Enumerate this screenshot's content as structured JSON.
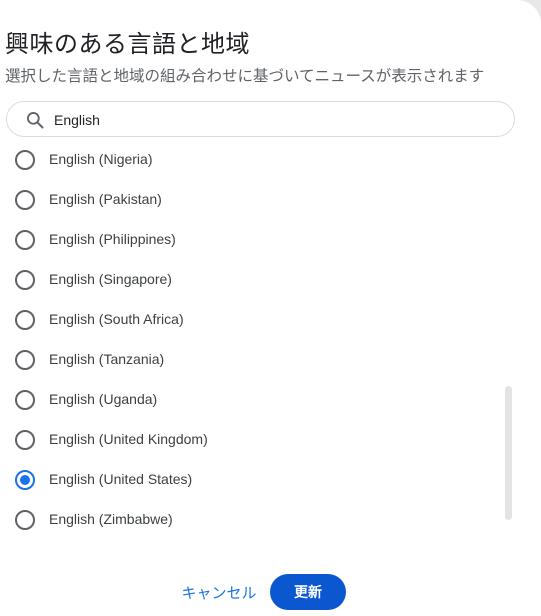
{
  "dialog": {
    "title": "興味のある言語と地域",
    "subtitle": "選択した言語と地域の組み合わせに基づいてニュースが表示されます"
  },
  "search": {
    "icon": "search-icon",
    "value": "English",
    "placeholder": ""
  },
  "options": [
    {
      "label": "English (Nigeria)",
      "checked": false
    },
    {
      "label": "English (Pakistan)",
      "checked": false
    },
    {
      "label": "English (Philippines)",
      "checked": false
    },
    {
      "label": "English (Singapore)",
      "checked": false
    },
    {
      "label": "English (South Africa)",
      "checked": false
    },
    {
      "label": "English (Tanzania)",
      "checked": false
    },
    {
      "label": "English (Uganda)",
      "checked": false
    },
    {
      "label": "English (United Kingdom)",
      "checked": false
    },
    {
      "label": "English (United States)",
      "checked": true
    },
    {
      "label": "English (Zimbabwe)",
      "checked": false
    }
  ],
  "actions": {
    "cancel_label": "キャンセル",
    "update_label": "更新"
  },
  "colors": {
    "accent": "#1a73e8",
    "primary_button": "#0b57d0",
    "text_primary": "#202124",
    "text_secondary": "#5f6368"
  }
}
